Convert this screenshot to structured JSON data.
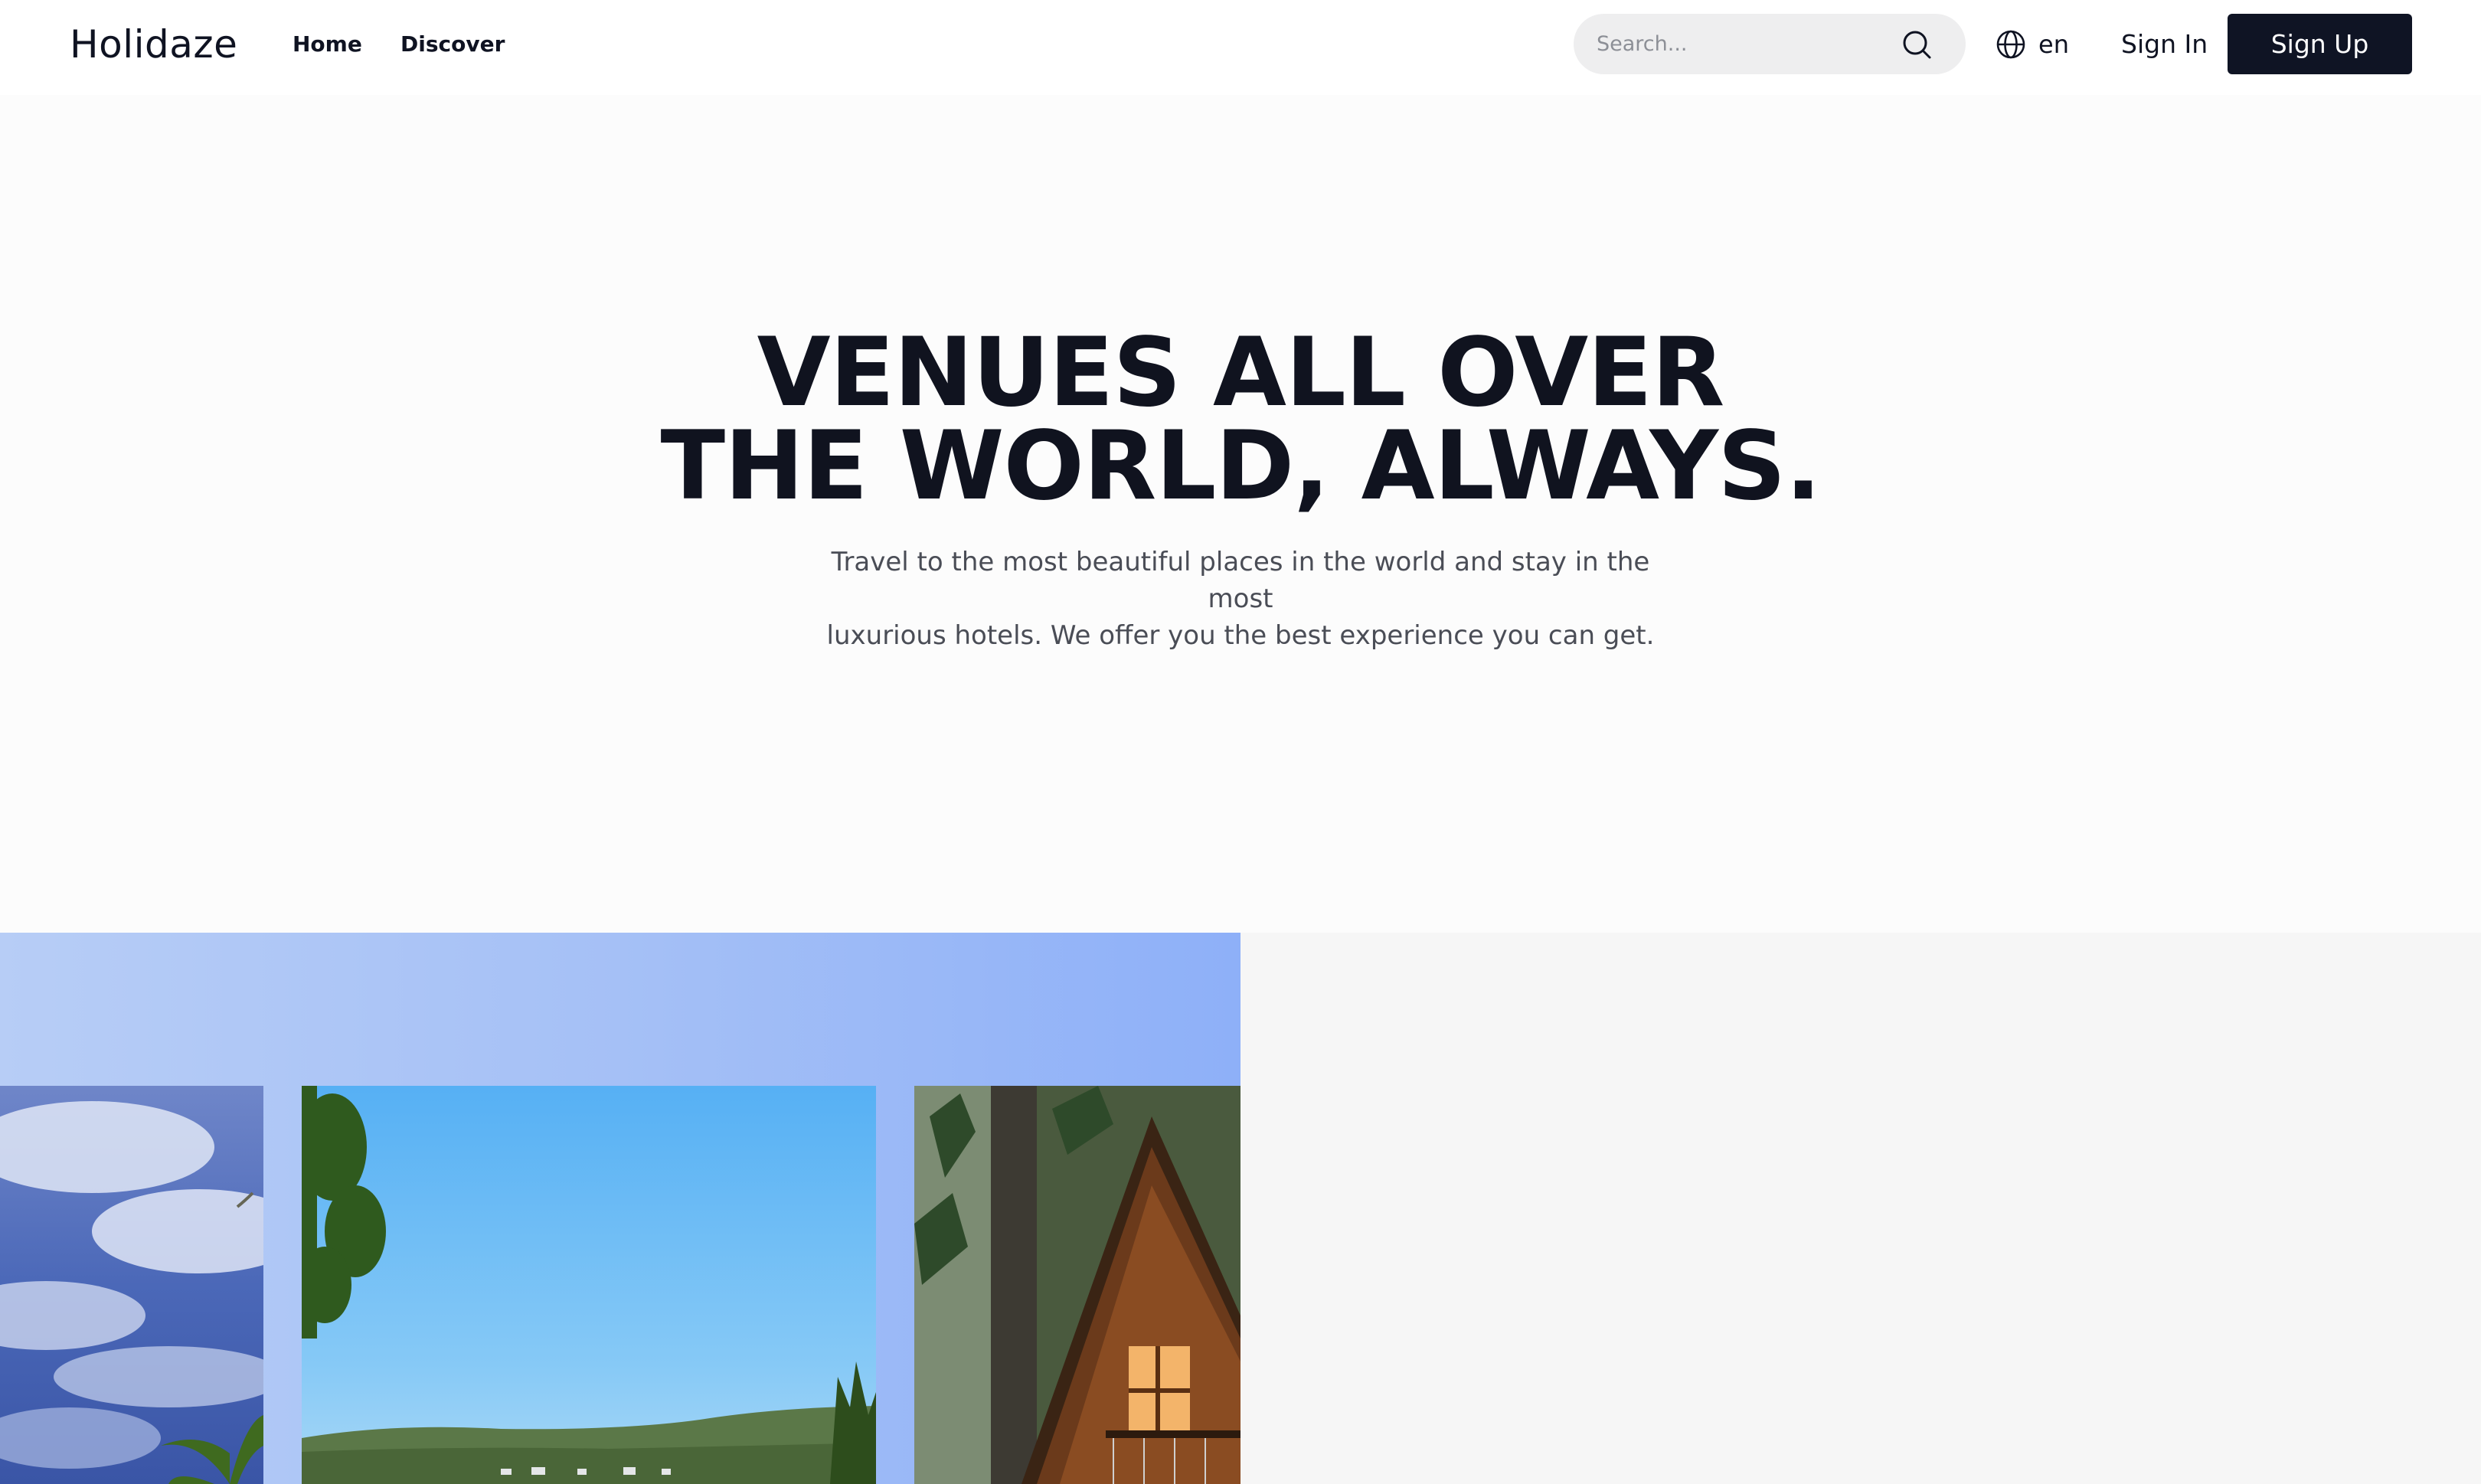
{
  "header": {
    "logo": "Holidaze",
    "nav": {
      "home": "Home",
      "discover": "Discover"
    },
    "search": {
      "placeholder": "Search...",
      "icon": "search-icon"
    },
    "language": {
      "label": "en",
      "icon": "globe-icon"
    },
    "sign_in": "Sign In",
    "sign_up": "Sign Up"
  },
  "hero": {
    "title_line1": "VENUES ALL OVER",
    "title_line2": "THE WORLD, ALWAYS.",
    "subtitle_line1": "Travel to the most beautiful places in the world and stay in the most",
    "subtitle_line2": "luxurious hotels. We offer you the best experience you can get."
  },
  "gallery": {
    "photos": [
      "tropical-sky-photo",
      "lakeside-town-photo",
      "forest-cabin-photo"
    ]
  },
  "colors": {
    "brand_dark": "#0f1424",
    "hero_background": "#fcfcfc",
    "search_background": "#eeeeef",
    "gallery_gradient_start": "#b7cdf6",
    "gallery_gradient_end": "#8eb0f8"
  }
}
